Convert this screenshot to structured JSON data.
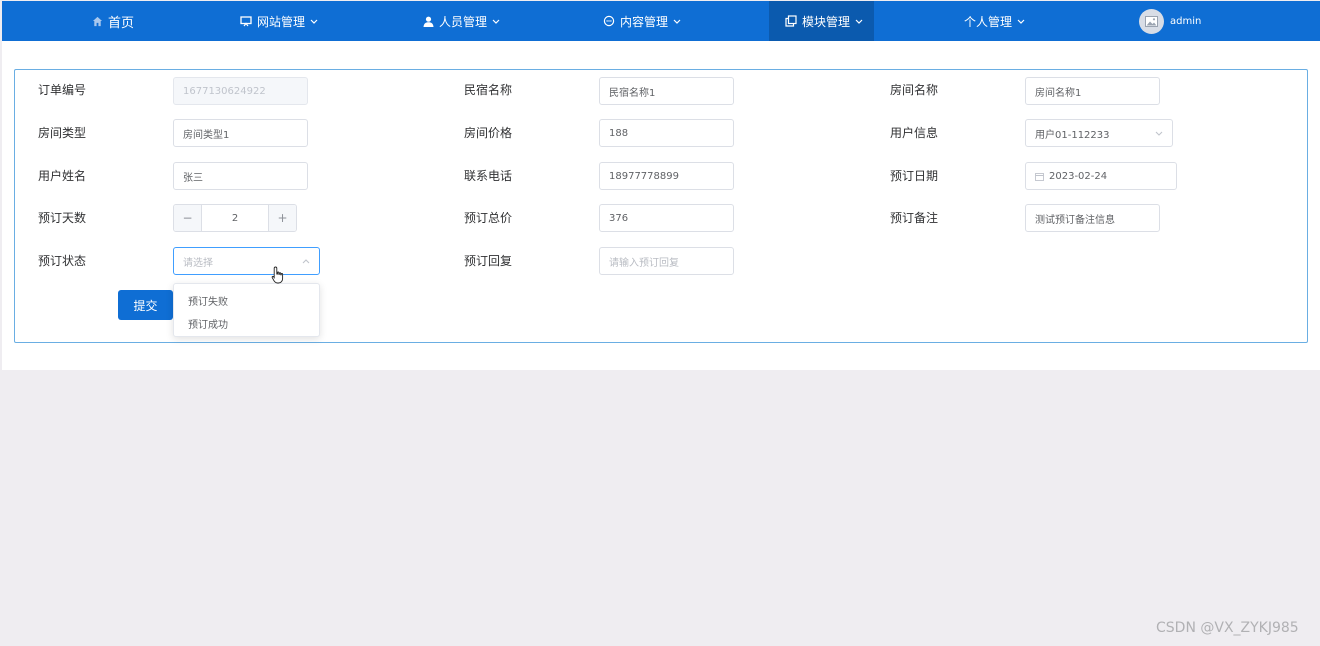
{
  "nav": {
    "home": "首页",
    "site_management": "网站管理",
    "staff_management": "人员管理",
    "content_management": "内容管理",
    "module_management": "模块管理",
    "personal_management": "个人管理",
    "username": "admin"
  },
  "colors": {
    "accent": "#0f6ed4",
    "active_nav": "#0b5aae",
    "card_border": "#6aaee3"
  },
  "form": {
    "order_no": {
      "label": "订单编号",
      "value": "1677130624922"
    },
    "homestay_name": {
      "label": "民宿名称",
      "value": "民宿名称1"
    },
    "room_name": {
      "label": "房间名称",
      "value": "房间名称1"
    },
    "room_type": {
      "label": "房间类型",
      "value": "房间类型1"
    },
    "room_price": {
      "label": "房间价格",
      "value": "188"
    },
    "user_info": {
      "label": "用户信息",
      "value": "用户01-112233"
    },
    "user_name": {
      "label": "用户姓名",
      "value": "张三"
    },
    "phone": {
      "label": "联系电话",
      "value": "18977778899"
    },
    "booking_date": {
      "label": "预订日期",
      "value": "2023-02-24"
    },
    "booking_days": {
      "label": "预订天数",
      "value": "2",
      "decrement": "−",
      "increment": "+"
    },
    "total_price": {
      "label": "预订总价",
      "value": "376"
    },
    "booking_note": {
      "label": "预订备注",
      "value": "测试预订备注信息"
    },
    "booking_status": {
      "label": "预订状态",
      "placeholder": "请选择",
      "options": [
        "预订失败",
        "预订成功"
      ]
    },
    "booking_reply": {
      "label": "预订回复",
      "placeholder": "请输入预订回复"
    },
    "submit_label": "提交"
  },
  "watermark": "CSDN @VX_ZYKJ985"
}
